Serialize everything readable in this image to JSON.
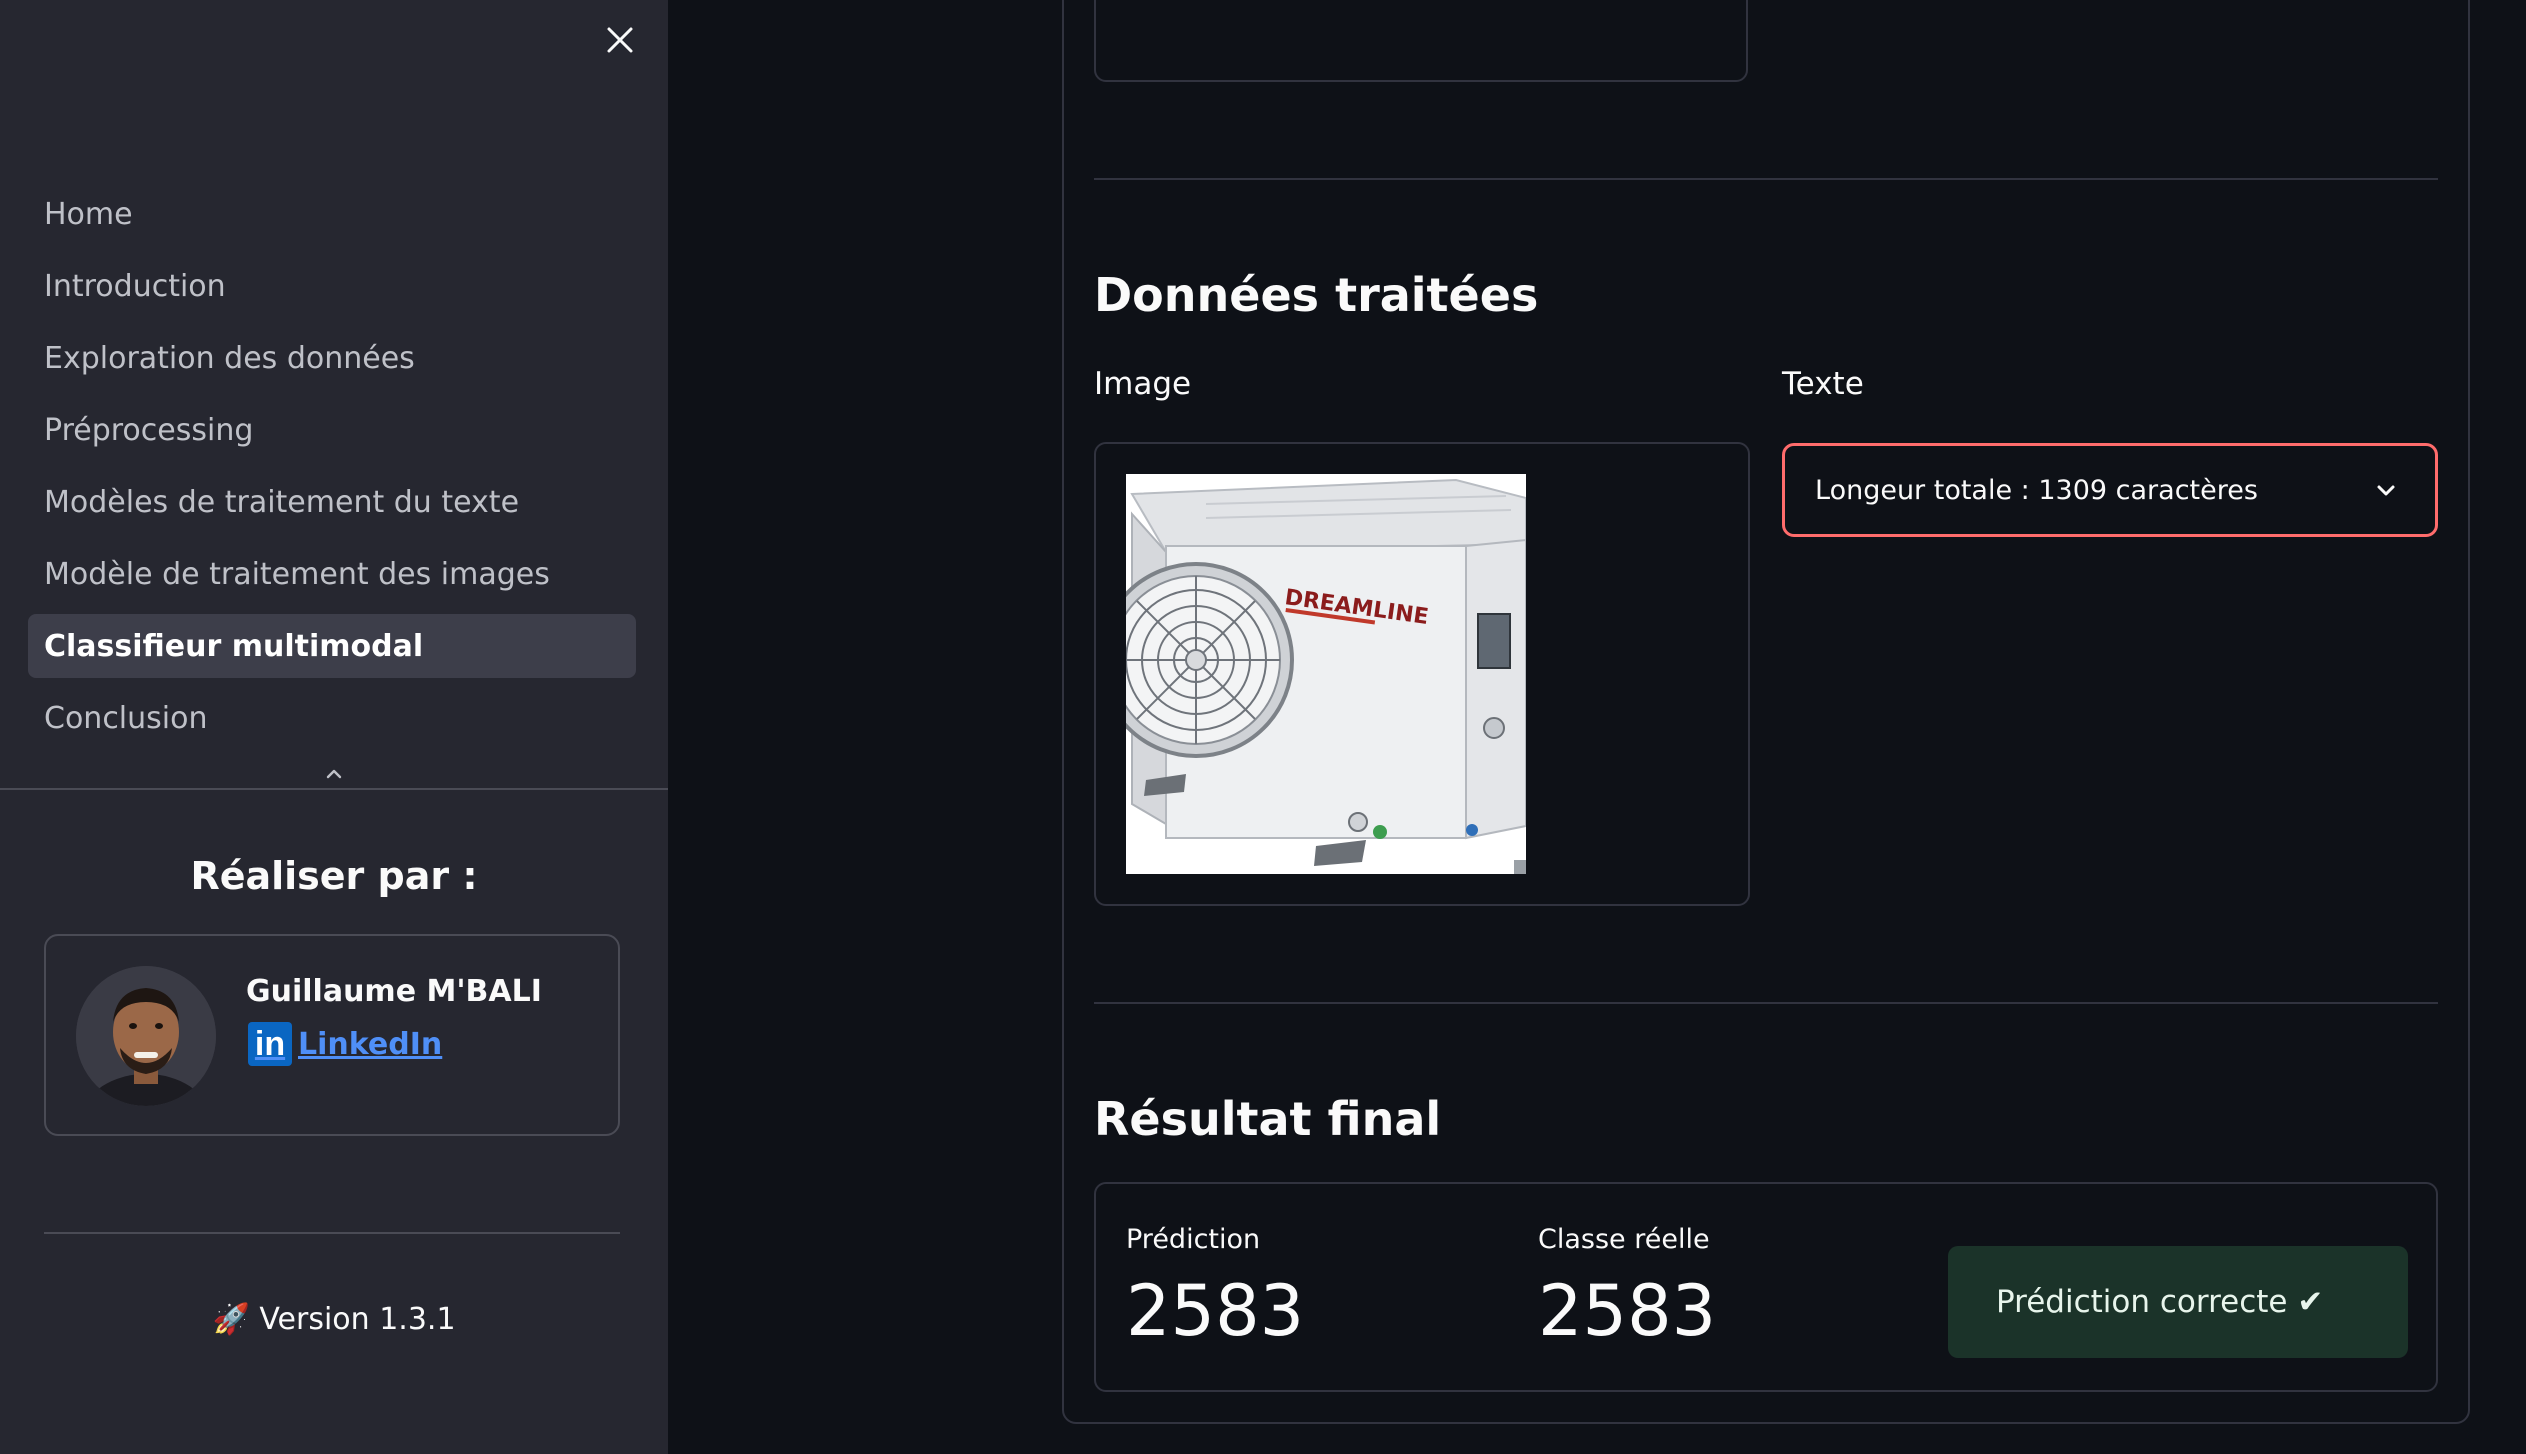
{
  "sidebar": {
    "close_icon": "close-icon",
    "nav_items": [
      {
        "label": "Home",
        "active": false
      },
      {
        "label": "Introduction",
        "active": false
      },
      {
        "label": "Exploration des données",
        "active": false
      },
      {
        "label": "Préprocessing",
        "active": false
      },
      {
        "label": "Modèles de traitement du texte",
        "active": false
      },
      {
        "label": "Modèle de traitement des images",
        "active": false
      },
      {
        "label": "Classifieur multimodal",
        "active": true
      },
      {
        "label": "Conclusion",
        "active": false
      }
    ],
    "author_heading": "Réaliser par :",
    "profile": {
      "name": "Guillaume M'BALI",
      "linkedin_icon_text": "in",
      "linkedin_label": " LinkedIn"
    },
    "version_icon": "🚀",
    "version_text": "Version 1.3.1"
  },
  "main": {
    "processed_title": "Données traitées",
    "image_label": "Image",
    "text_label": "Texte",
    "text_select_value": "Longeur totale : 1309 caractères",
    "product_image_brand": "DREAMLINE",
    "result_title": "Résultat final",
    "prediction_label": "Prédiction",
    "prediction_value": "2583",
    "actual_label": "Classe réelle",
    "actual_value": "2583",
    "success_message": "Prédiction correcte ✔"
  },
  "colors": {
    "sidebar_bg": "#262730",
    "main_bg": "#0e1117",
    "select_border": "#ff6c6c",
    "success_bg": "#1b3329",
    "link": "#4f8ff7"
  }
}
